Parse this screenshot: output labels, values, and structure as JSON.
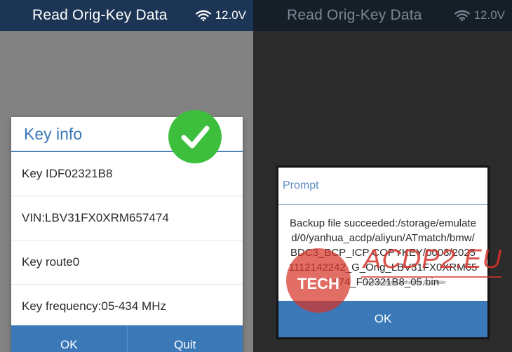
{
  "left_screen": {
    "title": "Read Orig-Key Data",
    "voltage": "12.0V",
    "dialog": {
      "title": "Key info",
      "rows": [
        {
          "text": "Key IDF02321B8"
        },
        {
          "text": "VIN:LBV31FX0XRM657474"
        },
        {
          "text": "Key route0"
        },
        {
          "text": "Key frequency:05-434 MHz"
        }
      ],
      "ok_label": "OK",
      "quit_label": "Quit"
    },
    "status_icon": "check-icon"
  },
  "right_screen": {
    "title": "Read Orig-Key Data",
    "voltage": "12.0V",
    "prompt": {
      "title": "Prompt",
      "message": "Backup file succeeded:/storage/emulated/0/yanhua_acdp/aliyun/ATmatch/bmw/BDC3_BCP_ICP COPYKEY/0003/20251112142242_G_Orig_LBV31FX0XRM657474_F02321B8_05.bin",
      "ok_label": "OK"
    }
  },
  "watermark": {
    "brand": "ACDP2.EU",
    "sub": "TECH",
    "tagline": "Yanhua Official Authorized EU Dealer"
  },
  "colors": {
    "header_bg": "#1c3554",
    "accent": "#3a78b8",
    "success": "#3dbf3d",
    "watermark": "#d6342a"
  }
}
